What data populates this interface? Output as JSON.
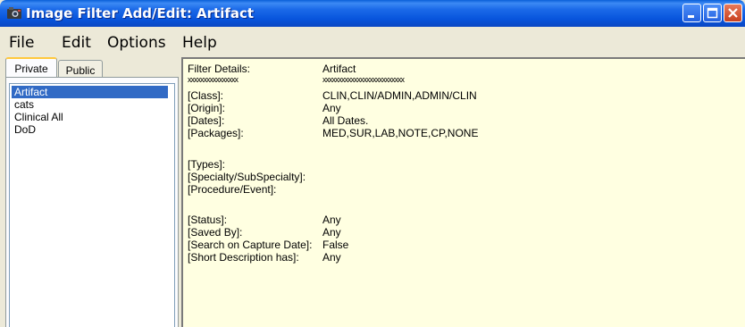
{
  "window": {
    "title": "Image Filter Add/Edit: Artifact"
  },
  "menu": {
    "file": "File",
    "edit": "Edit",
    "options": "Options",
    "help": "Help"
  },
  "tabs": {
    "private": "Private",
    "public": "Public"
  },
  "filter_list": [
    "Artifact",
    "cats",
    "Clinical All",
    "DoD"
  ],
  "details": {
    "header_label": "Filter Details:",
    "header_value": "Artifact",
    "header_label_underline": "xxxxxxxxxxxxxxxx",
    "header_value_underline": "xxxxxxxxxxxxxxxxxxxxxxxxxx",
    "class_label": "[Class]:",
    "class_value": "CLIN,CLIN/ADMIN,ADMIN/CLIN",
    "origin_label": "[Origin]:",
    "origin_value": "Any",
    "dates_label": "[Dates]:",
    "dates_value": "All Dates.",
    "packages_label": "[Packages]:",
    "packages_value": "MED,SUR,LAB,NOTE,CP,NONE",
    "types_label": "[Types]:",
    "specialty_label": "[Specialty/SubSpecialty]:",
    "procedure_label": "[Procedure/Event]:",
    "status_label": "[Status]:",
    "status_value": "Any",
    "savedby_label": "[Saved By]:",
    "savedby_value": "Any",
    "search_capture_label": "[Search on Capture Date]:",
    "search_capture_value": "False",
    "short_desc_label": "[Short Description has]:",
    "short_desc_value": "Any"
  },
  "colors": {
    "titlebar": "#0855dd",
    "selection": "#316ac5",
    "detail_background": "#ffffe1"
  }
}
